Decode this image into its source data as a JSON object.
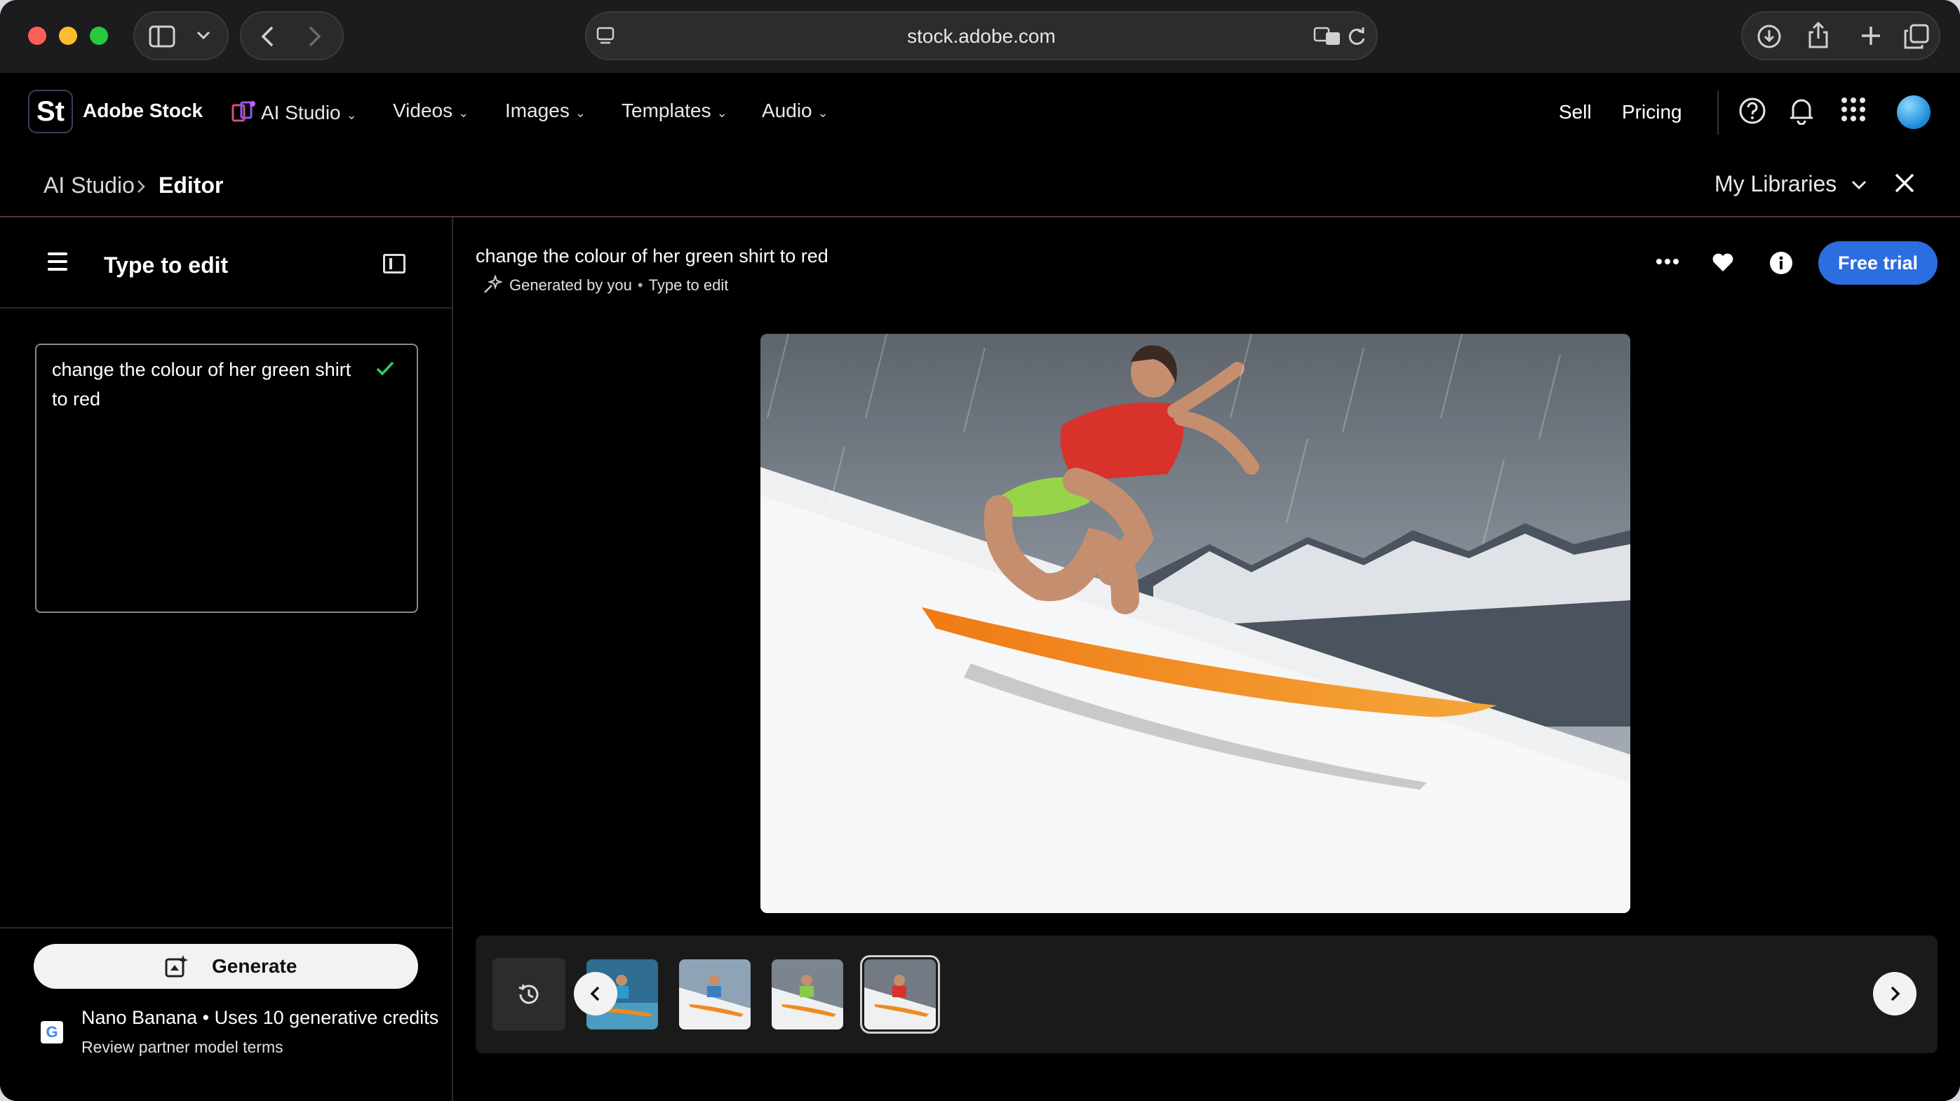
{
  "browser": {
    "address": "stock.adobe.com"
  },
  "header": {
    "logo_text": "St",
    "brand": "Adobe Stock",
    "nav": [
      "AI Studio",
      "Videos",
      "Images",
      "Templates",
      "Audio"
    ],
    "sell": "Sell",
    "pricing": "Pricing"
  },
  "breadcrumb": {
    "parent": "AI Studio",
    "current": "Editor",
    "my_libraries": "My Libraries"
  },
  "left_panel": {
    "title": "Type to edit",
    "prompt": "change the colour of her green shirt to red",
    "generate_label": "Generate",
    "model_line": "Nano Banana • Uses 10 generative credits",
    "terms": "Review partner model terms",
    "google_badge": "G"
  },
  "main": {
    "title": "change the colour of her green shirt to red",
    "generated_by": "Generated by you",
    "mode": "Type to edit",
    "free_trial": "Free trial"
  },
  "colors": {
    "accent": "#2c6ddf",
    "check": "#2ecc71"
  },
  "icons": [
    "sidebar-icon",
    "chevron-down-icon",
    "back-icon",
    "forward-icon",
    "reader-icon",
    "translate-icon",
    "reload-icon",
    "download-icon",
    "share-icon",
    "plus-icon",
    "tabs-icon",
    "help-icon",
    "bell-icon",
    "apps-grid-icon",
    "hamburger-icon",
    "panel-toggle-icon",
    "check-icon",
    "generate-icon",
    "more-icon",
    "heart-icon",
    "info-icon",
    "history-icon",
    "chevron-left-icon",
    "chevron-right-icon",
    "close-icon"
  ]
}
